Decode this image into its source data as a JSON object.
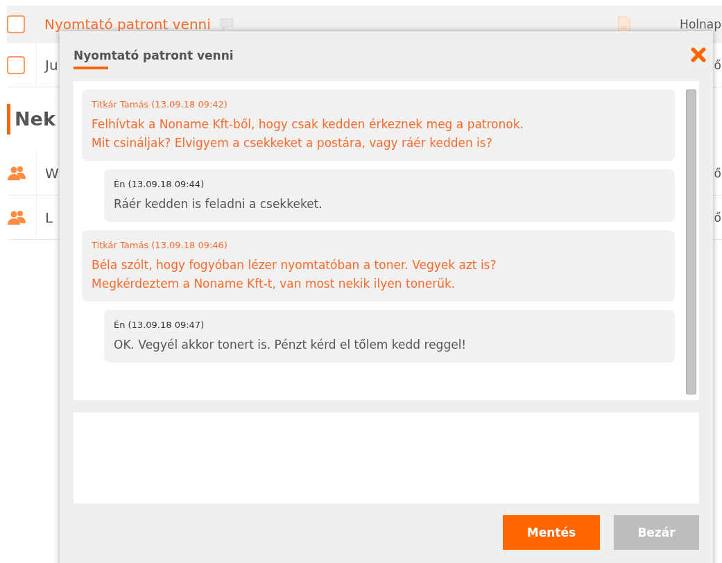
{
  "tasks": [
    {
      "checked": false,
      "highlighted": true,
      "title": "Nyomtató patront venni",
      "comment_icon": true,
      "file_icon": true,
      "due": "Holnap"
    },
    {
      "checked": false,
      "highlighted": false,
      "title": "Ju",
      "comment_icon": false,
      "file_icon": false,
      "due": "ő"
    }
  ],
  "section": {
    "title": "Nek"
  },
  "group_tasks": [
    {
      "title": "W",
      "due": "ő"
    },
    {
      "title": "L",
      "due": "ő"
    }
  ],
  "dialog": {
    "title": "Nyomtató patront venni",
    "messages": [
      {
        "kind": "other",
        "author": "Titkár Tamás (13.09.18 09:42)",
        "lines": [
          "Felhívtak a Noname Kft-ből, hogy csak kedden érkeznek meg a patronok.",
          "Mit csináljak? Elvigyem a csekkeket a postára, vagy ráér kedden is?"
        ]
      },
      {
        "kind": "mine",
        "author": "Én (13.09.18 09:44)",
        "lines": [
          "Ráér kedden is feladni a csekkeket."
        ]
      },
      {
        "kind": "other",
        "author": "Titkár Tamás (13.09.18 09:46)",
        "lines": [
          "Béla szólt, hogy fogyóban lézer nyomtatóban a toner. Vegyek azt is?",
          "Megkérdeztem a Noname Kft-t, van most nekik ilyen tonerük."
        ]
      },
      {
        "kind": "mine",
        "author": "Én (13.09.18 09:47)",
        "lines": [
          "OK. Vegyél akkor tonert is. Pénzt kérd el tőlem kedd reggel!"
        ]
      }
    ],
    "buttons": [
      {
        "kind": "primary",
        "label": "Mentés"
      },
      {
        "kind": "secondary",
        "label": "Bezár"
      }
    ]
  }
}
